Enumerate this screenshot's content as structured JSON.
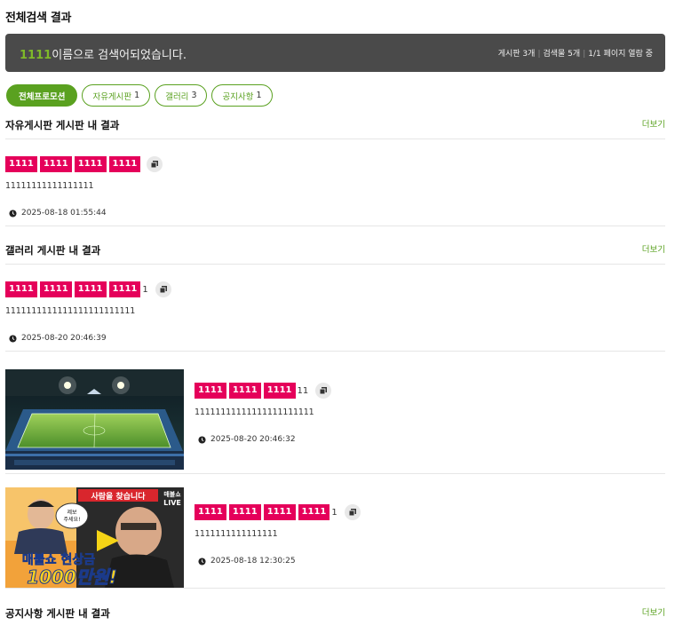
{
  "page": {
    "title": "전체검색 결과"
  },
  "banner": {
    "keyword": "1111",
    "message": "이름으로 검색어되었습니다.",
    "stats": [
      "게시판 3개",
      "검색물 5개",
      "1/1 페이지 열람 중"
    ]
  },
  "tabs": [
    {
      "label": "전체프로모션",
      "count": "",
      "active": true
    },
    {
      "label": "자유게시판",
      "count": "1",
      "active": false
    },
    {
      "label": "갤러리",
      "count": "3",
      "active": false
    },
    {
      "label": "공지사항",
      "count": "1",
      "active": false
    }
  ],
  "sections": {
    "free": {
      "title": "자유게시판 게시판 내 결과",
      "more": "더보기"
    },
    "gallery": {
      "title": "갤러리 게시판 내 결과",
      "more": "더보기"
    },
    "notice": {
      "title": "공지사항 게시판 내 결과",
      "more": "더보기"
    }
  },
  "results": {
    "free_1": {
      "tags": [
        "1111",
        "1111",
        "1111",
        "1111"
      ],
      "suffix": "",
      "excerpt": "11111111111111111",
      "date": "2025-08-18 01:55:44"
    },
    "gallery_1": {
      "tags": [
        "1111",
        "1111",
        "1111",
        "1111"
      ],
      "suffix": "1",
      "excerpt": "1111111111111111111111111",
      "date": "2025-08-20 20:46:39"
    },
    "gallery_2": {
      "tags": [
        "1111",
        "1111",
        "1111"
      ],
      "suffix": "11",
      "excerpt": "11111111111111111111111",
      "date": "2025-08-20 20:46:32"
    },
    "gallery_3": {
      "tags": [
        "1111",
        "1111",
        "1111",
        "1111"
      ],
      "suffix": "1",
      "excerpt": "1111111111111111",
      "date": "2025-08-18 12:30:25",
      "thumb_text": {
        "banner": "사람을 찾습니다",
        "brand": "매불쇼",
        "live": "LIVE",
        "bubble": "제보\n주세요!",
        "title": "매불쇼 현상금",
        "amount": "1000만원!"
      }
    }
  },
  "icons": {
    "copy": "copy-icon",
    "clock": "clock-icon"
  },
  "colors": {
    "accent": "#5aa120",
    "tag": "#e5005a",
    "banner_bg": "#4a4a4a"
  }
}
